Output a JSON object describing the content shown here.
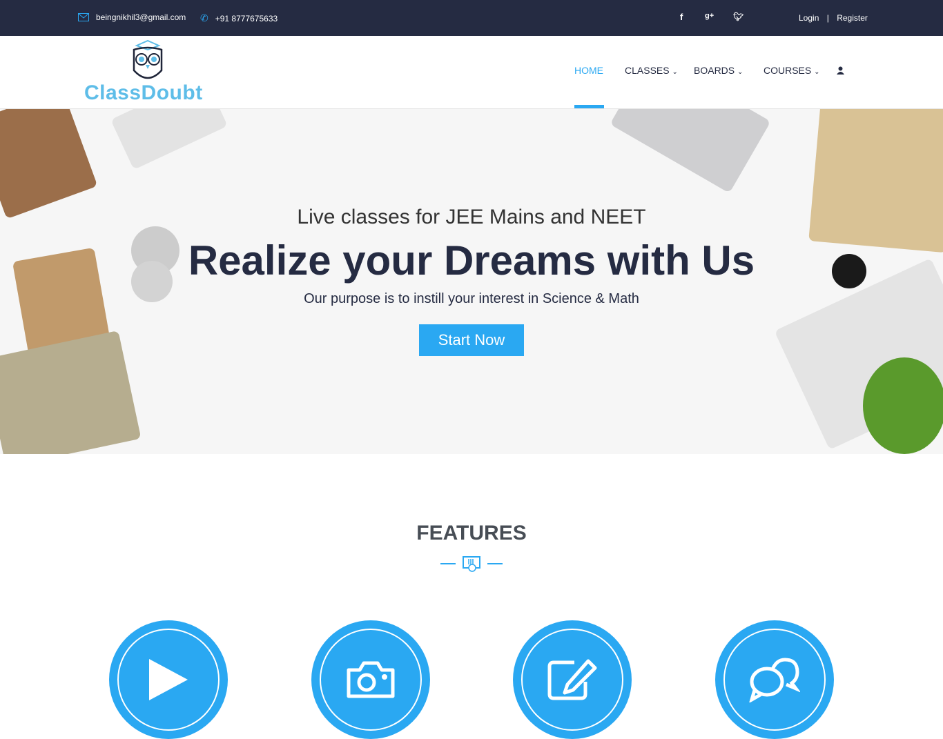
{
  "topbar": {
    "email": "beingnikhil3@gmail.com",
    "phone": "+91 8777675633",
    "social": [
      "facebook-icon",
      "google-plus-icon",
      "twitter-icon"
    ],
    "login": "Login",
    "separator": "|",
    "register": "Register"
  },
  "logo": {
    "text": "ClassDoubt"
  },
  "nav": {
    "items": [
      {
        "label": "HOME",
        "active": true
      },
      {
        "label": "CLASSES",
        "dropdown": true
      },
      {
        "label": "BOARDS",
        "dropdown": true
      },
      {
        "label": "COURSES",
        "dropdown": true
      }
    ],
    "user_icon": "user-icon"
  },
  "hero": {
    "subtitle": "Live classes for JEE Mains and NEET",
    "title": "Realize your Dreams with Us",
    "description": "Our purpose is to instill your interest in Science & Math",
    "button": "Start Now"
  },
  "features": {
    "title": "FEATURES",
    "icons": [
      "play-icon",
      "camera-icon",
      "edit-icon",
      "chat-icon"
    ]
  },
  "colors": {
    "accent": "#2aa8f2",
    "dark": "#252b42",
    "logo": "#5ebde8"
  }
}
